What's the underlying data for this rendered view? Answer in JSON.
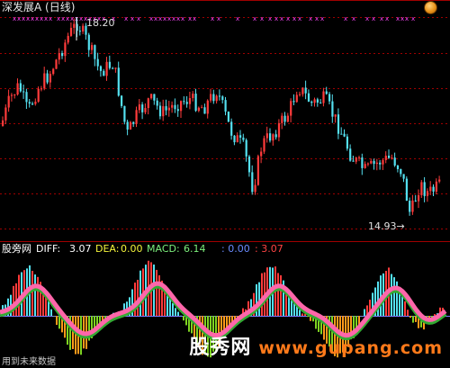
{
  "header": {
    "title": "深发展A (日线)",
    "high_label": "18.20",
    "low_label": "14.93→"
  },
  "indicator": {
    "name": "股旁网",
    "diff_label": "DIFF:",
    "diff_value": "3.07",
    "dea_label": "DEA:",
    "dea_value": "0.00",
    "macd_label": "MACD:",
    "macd_value": "6.14",
    "extra1": ": 0.00",
    "extra2": ": 3.07"
  },
  "watermark": {
    "cn": "股秀网",
    "url": "www.gupang.com"
  },
  "footer": {
    "note": "用到未来数据"
  },
  "colors": {
    "up": "#ff3b3b",
    "down": "#54e0f0",
    "grid": "#a00000",
    "marker": "#ff44ff",
    "zero": "#7a7aff",
    "neg_bar": "#ff9a1a",
    "neg_bar2": "#7ed321",
    "pink": "#ff66aa",
    "green": "#33aa33"
  },
  "icons": {
    "top_right": "options-button-icon"
  }
}
